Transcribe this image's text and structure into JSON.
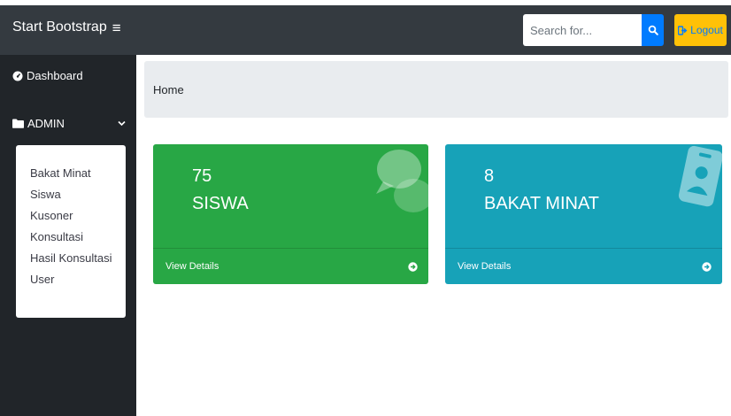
{
  "navbar": {
    "brand": "Start Bootstrap",
    "search_placeholder": "Search for...",
    "logout_label": "Logout"
  },
  "sidebar": {
    "dashboard_label": "Dashboard",
    "admin_label": "ADMIN",
    "submenu": [
      "Bakat Minat",
      "Siswa",
      "Kusoner",
      "Konsultasi",
      "Hasil Konsultasi",
      "User"
    ]
  },
  "breadcrumb": {
    "home": "Home"
  },
  "cards": [
    {
      "number": "75",
      "label": "SISWA",
      "footer": "View Details",
      "color": "#28a745",
      "icon": "comments-icon"
    },
    {
      "number": "8",
      "label": "BAKAT MINAT",
      "footer": "View Details",
      "color": "#17a2b8",
      "icon": "id-badge-icon"
    }
  ],
  "colors": {
    "navbar": "#343a40",
    "sidebar": "#212529",
    "search_button": "#007bff",
    "logout_button": "#ffc107",
    "breadcrumb": "#e9ecef"
  }
}
